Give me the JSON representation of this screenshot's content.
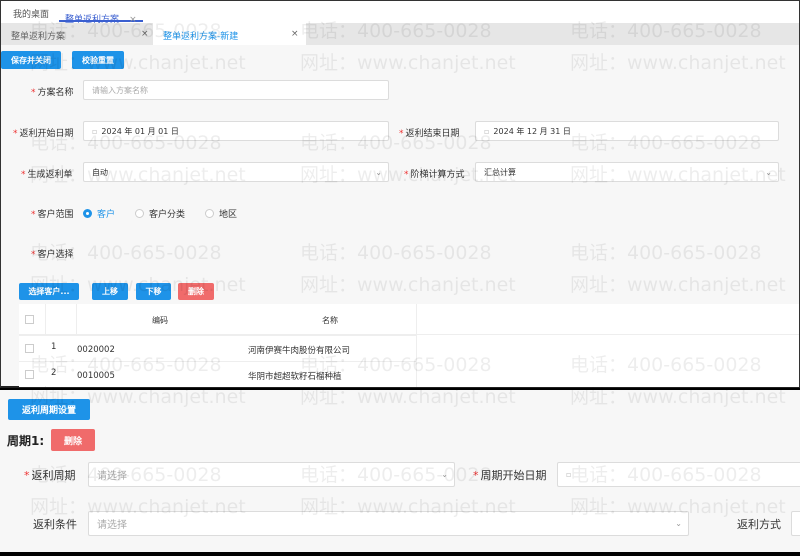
{
  "tabs_top": [
    {
      "label": "我的桌面"
    },
    {
      "label": "整单返利方案",
      "close": "×"
    }
  ],
  "tabs_second": [
    {
      "label": "整单返利方案",
      "close": "×"
    },
    {
      "label": "整单返利方案-新建",
      "close": "×"
    }
  ],
  "toolbar": {
    "save_close": "保存并关闭",
    "validate_reset": "校验重置"
  },
  "form": {
    "scheme_name": {
      "label": "方案名称",
      "placeholder": "请输入方案名称"
    },
    "start_date": {
      "label": "返利开始日期",
      "value": "2024 年 01 月 01 日"
    },
    "end_date": {
      "label": "返利结束日期",
      "value": "2024 年 12 月 31 日"
    },
    "gen_order": {
      "label": "生成返利单",
      "value": "自动"
    },
    "tier_calc": {
      "label": "阶梯计算方式",
      "value": "汇总计算"
    },
    "customer_scope": {
      "label": "客户范围",
      "options": [
        "客户",
        "客户分类",
        "地区"
      ],
      "selected": "客户"
    },
    "customer_select": {
      "label": "客户选择"
    }
  },
  "customer_actions": {
    "select": "选择客户...",
    "up": "上移",
    "down": "下移",
    "delete": "删除"
  },
  "table": {
    "headers": [
      "编码",
      "名称"
    ],
    "rows": [
      {
        "index": "1",
        "code": "0020002",
        "name": "河南伊赛牛肉股份有限公司"
      },
      {
        "index": "2",
        "code": "0010005",
        "name": "华阴市超超软籽石榴种植"
      }
    ]
  },
  "period": {
    "settings_button": "返利周期设置",
    "title": "周期1:",
    "delete": "删除",
    "cycle": {
      "label": "返利周期",
      "placeholder": "请选择"
    },
    "start": {
      "label": "周期开始日期"
    },
    "condition": {
      "label": "返利条件",
      "placeholder": "请选择"
    },
    "method": {
      "label": "返利方式"
    }
  },
  "watermark": {
    "phone": "电话：400-665-0028",
    "site": "网址：www.chanjet.net"
  }
}
